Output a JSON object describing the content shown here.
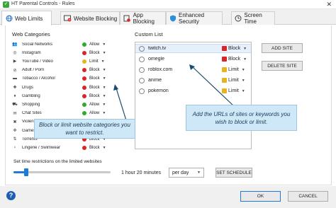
{
  "window": {
    "title": "HT Parental Controls - Rules",
    "app_icon_glyph": "✓",
    "close_glyph": "✕"
  },
  "tabs": [
    {
      "label": "Web Limits",
      "icon": "globe-icon",
      "active": true
    },
    {
      "label": "Website Blocking",
      "icon": "website-blocking-icon",
      "active": false
    },
    {
      "label": "App Blocking",
      "icon": "app-blocking-icon",
      "active": false
    },
    {
      "label": "Enhanced Security",
      "icon": "shield-icon",
      "active": false
    },
    {
      "label": "Screen Time",
      "icon": "clock-icon",
      "active": false
    }
  ],
  "web_categories": {
    "title": "Web Categories",
    "items": [
      {
        "label": "Social Networks",
        "status": "Allow",
        "icon": "people-icon"
      },
      {
        "label": "Instagram",
        "status": "Block",
        "icon": "instagram-icon"
      },
      {
        "label": "YouTube / Video",
        "status": "Limit",
        "icon": "video-icon"
      },
      {
        "label": "Adult / Porn",
        "status": "Block",
        "icon": "adult-icon"
      },
      {
        "label": "Tobacco / Alcohol",
        "status": "Block",
        "icon": "tobacco-icon"
      },
      {
        "label": "Drugs",
        "status": "Block",
        "icon": "drugs-icon"
      },
      {
        "label": "Gambling",
        "status": "Block",
        "icon": "gambling-icon"
      },
      {
        "label": "Shopping",
        "status": "Allow",
        "icon": "shopping-icon"
      },
      {
        "label": "Chat Sites",
        "status": "Allow",
        "icon": "chat-icon"
      },
      {
        "label": "Violence",
        "status": "Block",
        "icon": "violence-icon"
      },
      {
        "label": "Games",
        "status": "Limit",
        "icon": "games-icon"
      },
      {
        "label": "Torrents",
        "status": "Block",
        "icon": "torrents-icon"
      },
      {
        "label": "Lingerie / Swimwear",
        "status": "Block",
        "icon": "lingerie-icon"
      }
    ]
  },
  "custom_list": {
    "title": "Custom List",
    "items": [
      {
        "site": "twitch.tv",
        "status": "Block"
      },
      {
        "site": "omegle",
        "status": "Block"
      },
      {
        "site": "roblox.com",
        "status": "Limit"
      },
      {
        "site": "anime",
        "status": "Limit"
      },
      {
        "site": "pokemon",
        "status": "Limit"
      }
    ],
    "add_button": "ADD SITE",
    "delete_button": "DELETE SITE"
  },
  "callouts": {
    "categories": "Block or limit website categories you want to restrict.",
    "custom": "Add the URLs of sites or keywords you wish to block or limit."
  },
  "time_limit": {
    "label": "Set time restrictions on the limited websites",
    "value_text": "1 hour 20 minutes",
    "slider_fraction": 0.13,
    "period": "per day",
    "schedule_button": "SET SCHEDULE"
  },
  "footer": {
    "help": "?",
    "ok": "OK",
    "cancel": "CANCEL"
  },
  "colors": {
    "allow": "#2eaa2e",
    "block": "#d9252a",
    "limit": "#e6b321",
    "accent": "#1e7bd6",
    "callout_bg": "#cfe8f8"
  }
}
